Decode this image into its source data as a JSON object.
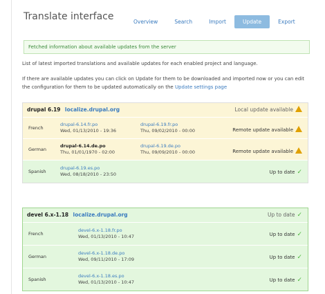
{
  "page": {
    "title": "Translate interface",
    "tabs": [
      {
        "label": "Overview",
        "active": false
      },
      {
        "label": "Search",
        "active": false
      },
      {
        "label": "Import",
        "active": false
      },
      {
        "label": "Update",
        "active": true
      },
      {
        "label": "Export",
        "active": false
      }
    ]
  },
  "message": "Fetched information about available updates from the server",
  "description_1": "List of latest imported translations and available updates for each enabled project and language.",
  "description_2_text": "If there are available updates you can click on Update for them to be downloaded and imported now or you can edit the configuration for them to be updated automatically on the",
  "description_2_link": "Update settings page",
  "projects": [
    {
      "name": "drupal 6.19",
      "link": "localize.drupal.org",
      "status": "Local update available",
      "rows": [
        {
          "language": "French",
          "local_file": "drupal-6.14.fr.po",
          "local_date": "Wed, 01/13/2010 - 19:36",
          "remote_file": "drupal-6.19.fr.po",
          "remote_date": "Thu, 09/02/2010 - 00:00",
          "status": "Remote update available"
        },
        {
          "language": "German",
          "local_file": "drupal-6.14.de.po",
          "local_date": "Thu, 01/01/1970 - 02:00",
          "remote_file": "drupal-6.19.de.po",
          "remote_date": "Thu, 09/09/2010 - 00:00",
          "status": "Remote update available"
        },
        {
          "language": "Spanish",
          "local_file": "drupal-6.19.es.po",
          "local_date": "Wed, 08/18/2010 - 23:50",
          "remote_file": "",
          "remote_date": "",
          "status": "Up to date"
        }
      ]
    },
    {
      "name": "devel 6.x-1.18",
      "link": "localize.drupal.org",
      "status": "Up to date",
      "rows": [
        {
          "language": "French",
          "local_file": "devel-6.x-1.18.fr.po",
          "local_date": "Wed, 01/13/2010 - 10:47",
          "status": "Up to date"
        },
        {
          "language": "German",
          "local_file": "devel-6.x-1.18.de.po",
          "local_date": "Wed, 09/11/2010 - 17:09",
          "status": "Up to date"
        },
        {
          "language": "Spanish",
          "local_file": "devel-6.x-1.18.es.po",
          "local_date": "Wed, 01/13/2010 - 10:47",
          "status": "Up to date"
        }
      ]
    }
  ],
  "colors": {
    "link": "#3a7bbf",
    "warning": "#e0a000",
    "ok": "#4cb43c",
    "yellow_bg": "#fcf5d6",
    "green_bg": "#e3f7de"
  },
  "icons": {
    "warning": "warning-triangle-icon",
    "ok": "checkmark-icon"
  }
}
